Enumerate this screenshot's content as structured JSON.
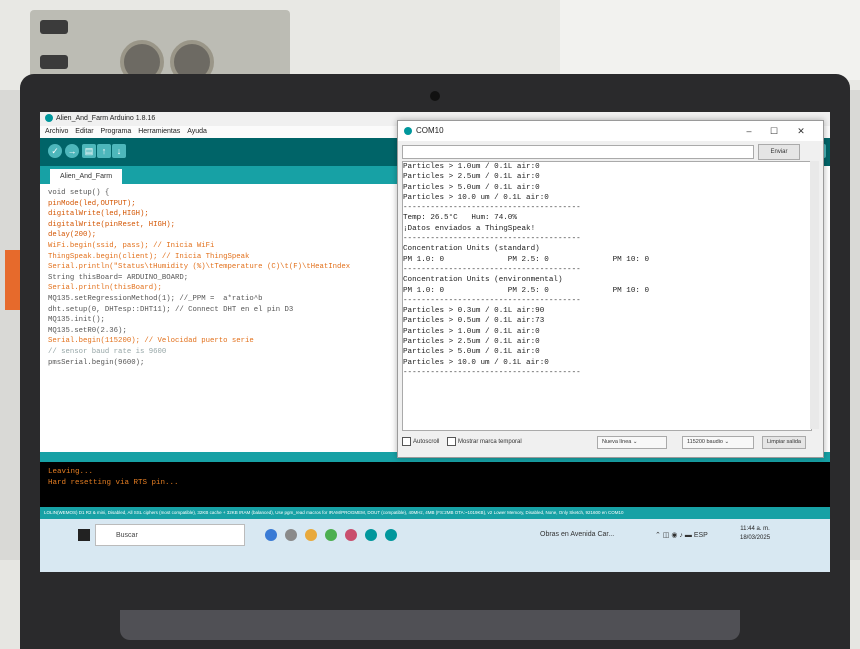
{
  "ide": {
    "window_title": "Alien_And_Farm Arduino 1.8.16",
    "menu": [
      "Archivo",
      "Editar",
      "Programa",
      "Herramientas",
      "Ayuda"
    ],
    "tab_label": "Alien_And_Farm",
    "code_lines": [
      "void setup() {",
      "pinMode(led,OUTPUT);",
      "digitalWrite(led,HIGH);",
      "digitalWrite(pinReset, HIGH);",
      "delay(200);",
      "WiFi.begin(ssid, pass); // Inicia WiFi",
      "ThingSpeak.begin(client); // Inicia ThingSpeak",
      "",
      "",
      "Serial.println(\"Status\\tHumidity (%)\\tTemperature (C)\\t(F)\\tHeatIndex",
      "String thisBoard= ARDUINO_BOARD;",
      "Serial.println(thisBoard);",
      "",
      "",
      "MQ135.setRegressionMethod(1); //_PPM =  a*ratio^b",
      "dht.setup(0, DHTesp::DHT11); // Connect DHT en el pin D3",
      "MQ135.init();",
      "",
      "MQ135.setR0(2.36);",
      "Serial.begin(115200); // Velocidad puerto serie",
      "// sensor baud rate is 9600",
      "pmsSerial.begin(9600);"
    ],
    "console_lines": [
      "Leaving...",
      "Hard resetting via RTS pin..."
    ],
    "status_bar": "LOLIN(WEMOS) D1 R2 & mini, Disabled, All SSL ciphers (most compatible), 32KB cache + 32KB IRAM (balanced), Use pgm_read macros for IRAM/PROGMEM, DOUT (compatible), 40MHz, 4MB (FS:2MB OTA:~1019KB), v2 Lower Memory, Disabled, None, Only Sketch, 921600 en COM10"
  },
  "serial_monitor": {
    "title": "COM10",
    "send_label": "Enviar",
    "output_lines": [
      "Particles > 1.0um / 0.1L air:0",
      "Particles > 2.5um / 0.1L air:0",
      "Particles > 5.0um / 0.1L air:0",
      "Particles > 10.0 um / 0.1L air:0",
      "---------------------------------------",
      "Temp: 26.5°C   Hum: 74.0%",
      "¡Datos enviados a ThingSpeak!",
      "",
      "---------------------------------------",
      "Concentration Units (standard)",
      "PM 1.0: 0              PM 2.5: 0              PM 10: 0",
      "---------------------------------------",
      "Concentration Units (environmental)",
      "PM 1.0: 0              PM 2.5: 0              PM 10: 0",
      "---------------------------------------",
      "Particles > 0.3um / 0.1L air:90",
      "Particles > 0.5um / 0.1L air:73",
      "Particles > 1.0um / 0.1L air:0",
      "Particles > 2.5um / 0.1L air:0",
      "Particles > 5.0um / 0.1L air:0",
      "Particles > 10.0 um / 0.1L air:0",
      "---------------------------------------"
    ],
    "autoscroll_label": "Autoscroll",
    "timestamp_label": "Mostrar marca temporal",
    "line_ending": "Nueva línea",
    "baud_rate": "115200 baudio",
    "clear_label": "Limpiar salida"
  },
  "taskbar": {
    "search_placeholder": "Buscar",
    "weather_text": "Obras en Avenida Car...",
    "language": "ESP",
    "time": "11:44 a. m.",
    "date": "18/03/2025"
  },
  "colors": {
    "arduino_teal": "#00979c",
    "console_text": "#e67e22"
  }
}
